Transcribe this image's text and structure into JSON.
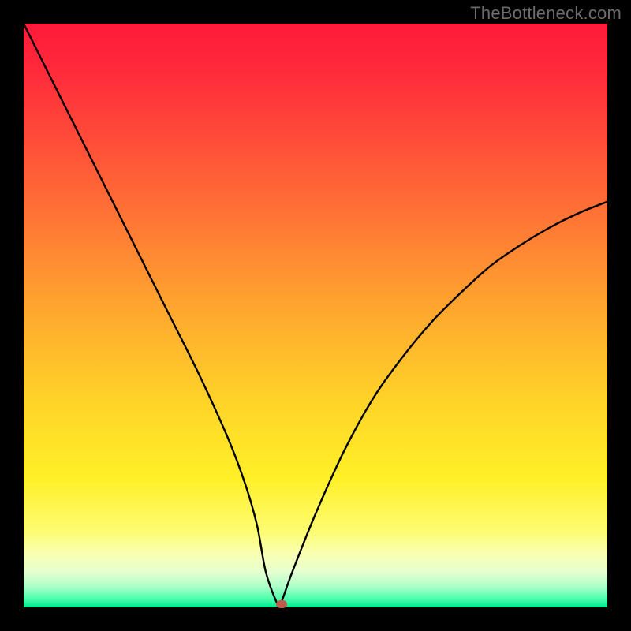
{
  "watermark": {
    "text": "TheBottleneck.com"
  },
  "colors": {
    "frame": "#000000",
    "gradient_stops": [
      {
        "offset": 0.0,
        "color": "#ff1a3a"
      },
      {
        "offset": 0.08,
        "color": "#ff2a3b"
      },
      {
        "offset": 0.2,
        "color": "#ff4c39"
      },
      {
        "offset": 0.35,
        "color": "#ff7a34"
      },
      {
        "offset": 0.5,
        "color": "#ffaa2e"
      },
      {
        "offset": 0.65,
        "color": "#ffd428"
      },
      {
        "offset": 0.78,
        "color": "#fff028"
      },
      {
        "offset": 0.87,
        "color": "#fdfc72"
      },
      {
        "offset": 0.91,
        "color": "#f9ffb4"
      },
      {
        "offset": 0.94,
        "color": "#e4ffd0"
      },
      {
        "offset": 0.965,
        "color": "#a9ffc8"
      },
      {
        "offset": 0.985,
        "color": "#4dffad"
      },
      {
        "offset": 1.0,
        "color": "#00e98f"
      }
    ],
    "curve": "#000000",
    "marker": "#c05a4a"
  },
  "chart_data": {
    "type": "line",
    "title": "",
    "xlabel": "",
    "ylabel": "",
    "xlim": [
      0,
      100
    ],
    "ylim": [
      0,
      100
    ],
    "series": [
      {
        "name": "bottleneck-curve",
        "x": [
          0,
          5,
          10,
          15,
          20,
          25,
          30,
          35,
          38,
          40,
          41.5,
          43.5,
          44,
          46,
          50,
          55,
          60,
          65,
          70,
          75,
          80,
          85,
          90,
          95,
          100
        ],
        "y": [
          100,
          90,
          80,
          70,
          60,
          50,
          40,
          29,
          21,
          14,
          6,
          0.5,
          0.5,
          6,
          16,
          27,
          36,
          43,
          49,
          54,
          58.5,
          62,
          65,
          67.5,
          69.5
        ]
      }
    ],
    "flat_segment": {
      "x_start": 41.5,
      "x_end": 44,
      "y": 0.5
    },
    "marker": {
      "x": 44.2,
      "y": 0.5
    }
  }
}
